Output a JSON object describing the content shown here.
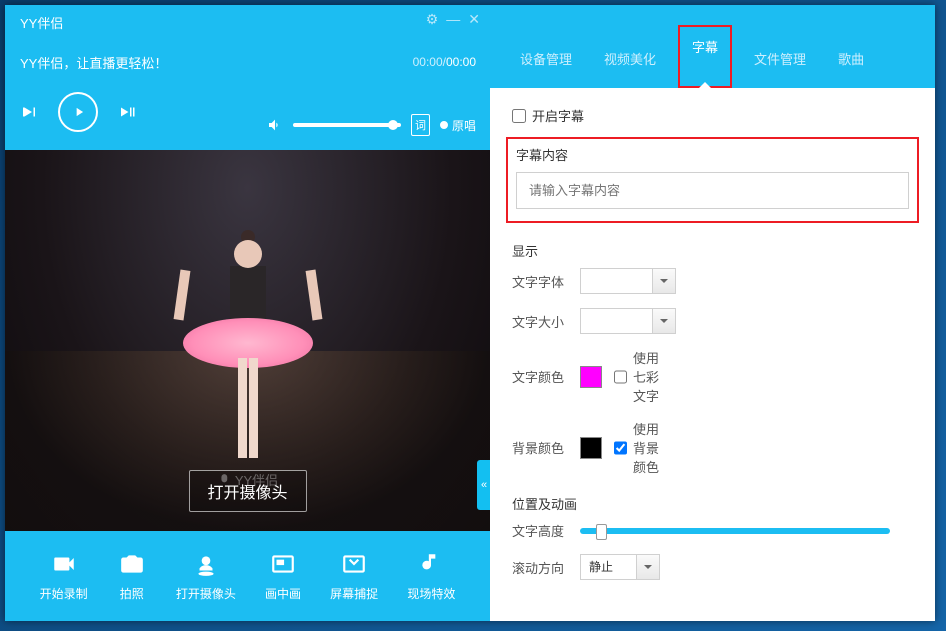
{
  "left": {
    "title": "YY伴侣",
    "subtitle": "YY伴侣，让直播更轻松！",
    "time_current": "00:00",
    "time_total": "00:00",
    "lyric_btn": "词",
    "original_sing": "原唱",
    "open_camera": "打开摄像头",
    "watermark": "YY伴侣",
    "bottom": [
      {
        "label": "开始录制"
      },
      {
        "label": "拍照"
      },
      {
        "label": "打开摄像头"
      },
      {
        "label": "画中画"
      },
      {
        "label": "屏幕捕捉"
      },
      {
        "label": "现场特效"
      }
    ],
    "collapse": "«"
  },
  "right": {
    "tabs": [
      "设备管理",
      "视频美化",
      "字幕",
      "文件管理",
      "歌曲"
    ],
    "active_tab": 2,
    "enable_subtitle": "开启字幕",
    "subtitle_section": "字幕内容",
    "subtitle_placeholder": "请输入字幕内容",
    "display_section": "显示",
    "font_label": "文字字体",
    "size_label": "文字大小",
    "textcolor_label": "文字颜色",
    "textcolor_value": "#ff00ff",
    "rainbow_text": "使用七彩文字",
    "rainbow_checked": false,
    "bgcolor_label": "背景颜色",
    "bgcolor_value": "#000000",
    "use_bg": "使用背景颜色",
    "use_bg_checked": true,
    "pos_section": "位置及动画",
    "height_label": "文字高度",
    "scroll_label": "滚动方向",
    "scroll_value": "静止"
  }
}
